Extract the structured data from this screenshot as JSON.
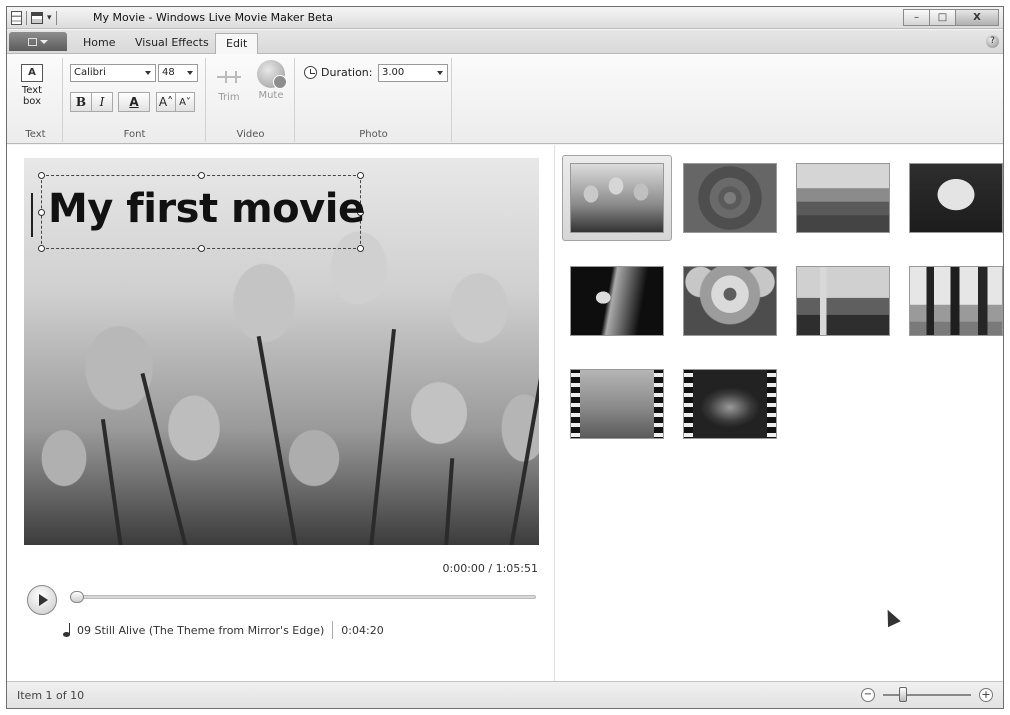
{
  "window": {
    "title": "My Movie - Windows Live Movie Maker Beta",
    "controls": {
      "minimize": "–",
      "maximize": "□",
      "close": "X"
    }
  },
  "ribbon_tabs": [
    {
      "label": "Home",
      "active": false
    },
    {
      "label": "Visual Effects",
      "active": false
    },
    {
      "label": "Edit",
      "active": true
    }
  ],
  "ribbon": {
    "text_group": {
      "label": "Text",
      "textbox_label": "Text box",
      "textbox_icon_text": "A"
    },
    "font_group": {
      "label": "Font",
      "font_family": "Calibri",
      "font_size": "48",
      "bold": "B",
      "italic": "I",
      "font_color": "A",
      "grow_font": "A˄",
      "shrink_font": "A˅"
    },
    "video_group": {
      "label": "Video",
      "trim_label": "Trim",
      "mute_label": "Mute"
    },
    "photo_group": {
      "label": "Photo",
      "duration_label": "Duration:",
      "duration_value": "3.00"
    }
  },
  "preview": {
    "overlay_text": "My first movie",
    "timecode": "0:00:00 / 1:05:51",
    "music_title": "09 Still Alive (The Theme from Mirror's Edge)",
    "music_duration": "0:04:20",
    "progress": 0
  },
  "storyboard": {
    "items": [
      {
        "name": "tulips",
        "type": "photo",
        "selected": true
      },
      {
        "name": "chrysanthemum",
        "type": "photo",
        "selected": false
      },
      {
        "name": "desert",
        "type": "photo",
        "selected": false
      },
      {
        "name": "hydrangeas",
        "type": "photo",
        "selected": false
      },
      {
        "name": "jellyfish",
        "type": "photo",
        "selected": false
      },
      {
        "name": "koala",
        "type": "photo",
        "selected": false
      },
      {
        "name": "lighthouse",
        "type": "photo",
        "selected": false
      },
      {
        "name": "penguins",
        "type": "photo",
        "selected": false
      },
      {
        "name": "video-1",
        "type": "video",
        "selected": false
      },
      {
        "name": "video-2",
        "type": "video",
        "selected": false
      }
    ]
  },
  "status": {
    "text": "Item 1 of 10",
    "zoom_out": "−",
    "zoom_in": "+",
    "zoom_level": 0.2
  },
  "icons": {
    "app": "app-icon",
    "save": "save-icon",
    "help": "help-icon",
    "play": "play-icon",
    "note": "music-note-icon",
    "clock": "clock-icon",
    "cursor": "mouse-cursor-icon"
  }
}
